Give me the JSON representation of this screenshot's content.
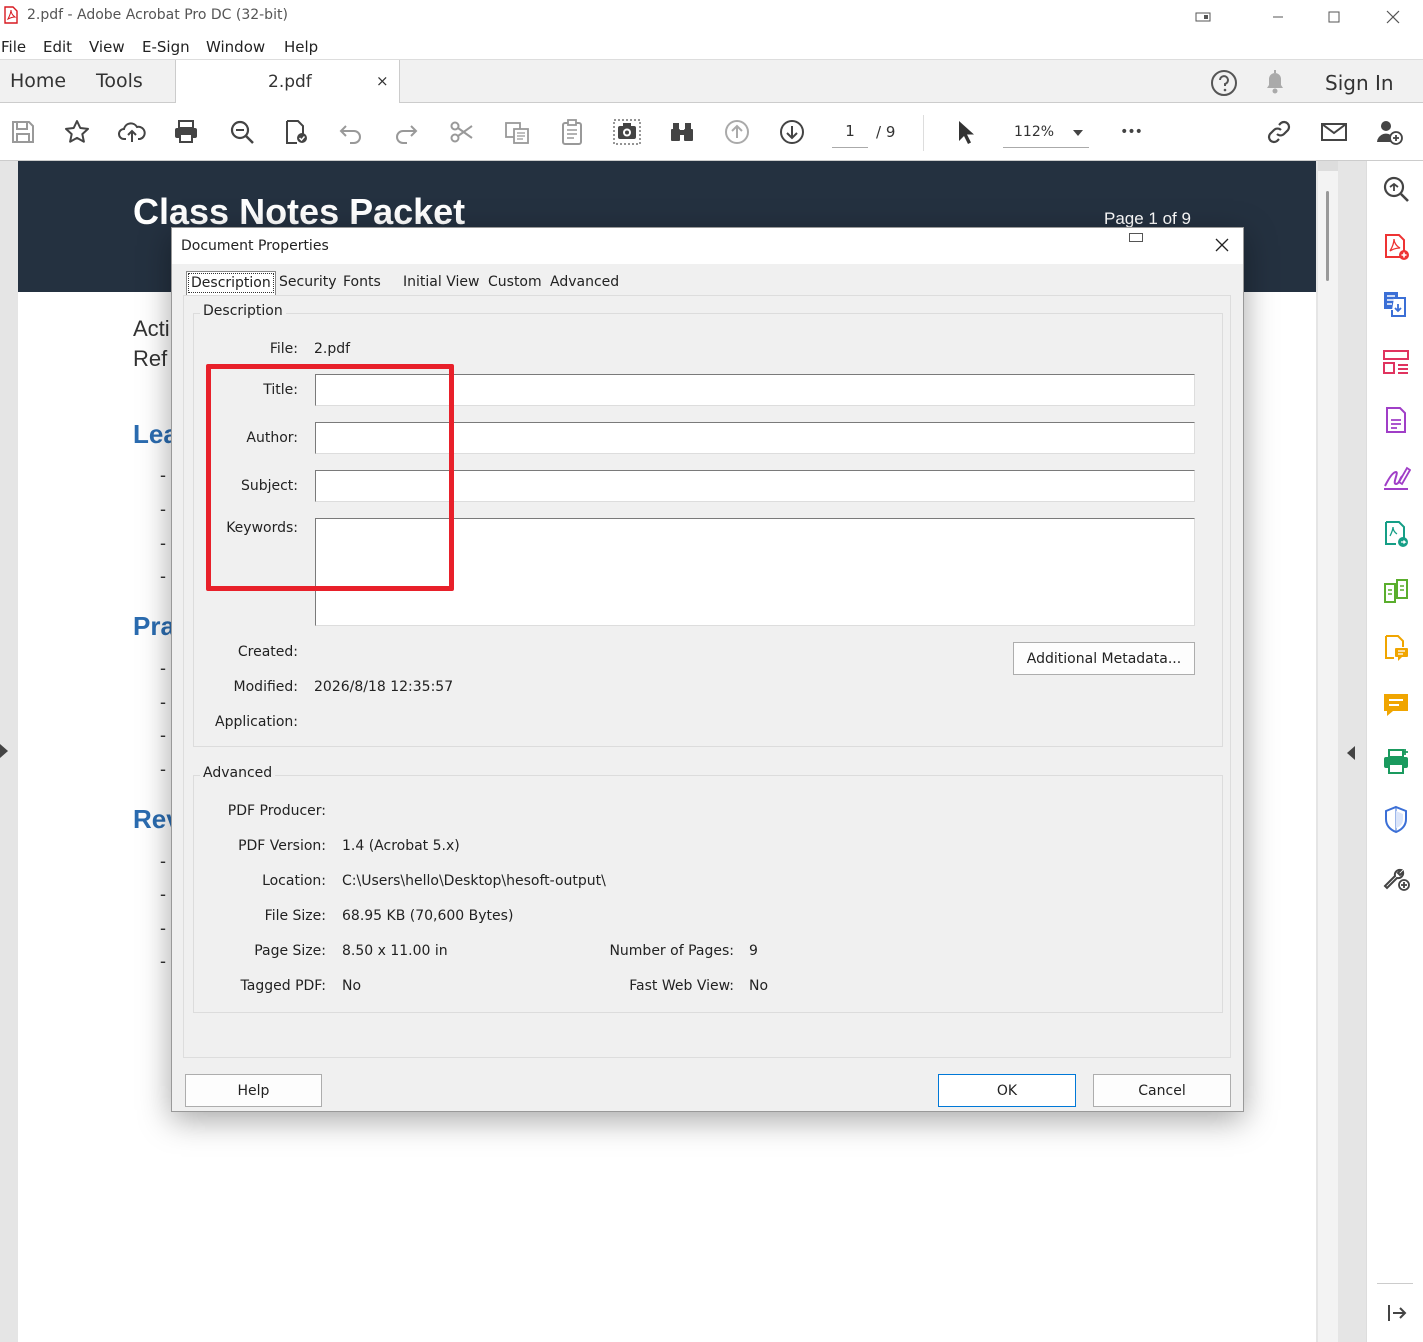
{
  "window": {
    "title": "2.pdf - Adobe Acrobat Pro DC (32-bit)"
  },
  "menubar": [
    "File",
    "Edit",
    "View",
    "E-Sign",
    "Window",
    "Help"
  ],
  "tabbar": {
    "home": "Home",
    "tools": "Tools",
    "document_tab": "2.pdf",
    "close_glyph": "×",
    "sign_in": "Sign In"
  },
  "toolbar": {
    "page_current": "1",
    "page_total": "/ 9",
    "zoom": "112%",
    "more_glyph": "•••"
  },
  "document": {
    "header_title": "Class Notes Packet",
    "header_page": "Page 1 of 9",
    "intro_lines": [
      "Acti",
      "Ref"
    ],
    "sections": [
      {
        "heading": "Lea",
        "bullets": [
          "-",
          "-",
          "-",
          "-"
        ]
      },
      {
        "heading": "Pra",
        "bullets": [
          "-",
          "-",
          "-",
          "-"
        ]
      },
      {
        "heading": "Rev",
        "bullets": [
          "-",
          "-",
          "-",
          "-"
        ]
      }
    ]
  },
  "dialog": {
    "title": "Document Properties",
    "tabs": [
      "Description",
      "Security",
      "Fonts",
      "Initial View",
      "Custom",
      "Advanced"
    ],
    "active_tab": "Description",
    "description_group": {
      "label": "Description",
      "file_label": "File:",
      "file_value": "2.pdf",
      "title_label": "Title:",
      "title_value": "",
      "author_label": "Author:",
      "author_value": "",
      "subject_label": "Subject:",
      "subject_value": "",
      "keywords_label": "Keywords:",
      "keywords_value": "",
      "created_label": "Created:",
      "created_value": "",
      "modified_label": "Modified:",
      "modified_value": "2026/8/18 12:35:57",
      "application_label": "Application:",
      "application_value": "",
      "additional_metadata_button": "Additional Metadata..."
    },
    "advanced_group": {
      "label": "Advanced",
      "pdf_producer_label": "PDF Producer:",
      "pdf_producer_value": "",
      "pdf_version_label": "PDF Version:",
      "pdf_version_value": "1.4 (Acrobat 5.x)",
      "location_label": "Location:",
      "location_value": "C:\\Users\\hello\\Desktop\\hesoft-output\\",
      "file_size_label": "File Size:",
      "file_size_value": "68.95 KB (70,600 Bytes)",
      "page_size_label": "Page Size:",
      "page_size_value": "8.50 x 11.00 in",
      "number_of_pages_label": "Number of Pages:",
      "number_of_pages_value": "9",
      "tagged_pdf_label": "Tagged PDF:",
      "tagged_pdf_value": "No",
      "fast_web_view_label": "Fast Web View:",
      "fast_web_view_value": "No"
    },
    "buttons": {
      "help": "Help",
      "ok": "OK",
      "cancel": "Cancel"
    }
  },
  "colors": {
    "highlight": "#e8202a",
    "doc_header": "#243140",
    "doc_heading": "#2b6cb0"
  },
  "icons": {
    "toolbar": [
      "save-icon",
      "star-icon",
      "upload-cloud-icon",
      "print-icon",
      "search-zoom-icon",
      "check-document-icon",
      "undo-icon",
      "redo-icon",
      "scissors-icon",
      "copy-icon",
      "clipboard-icon",
      "snapshot-icon",
      "binoculars-icon",
      "page-up-icon",
      "page-down-icon",
      "cursor-icon",
      "more-icon",
      "link-icon",
      "email-icon",
      "add-user-icon"
    ],
    "right_panel": [
      "zoom-icon",
      "create-pdf-icon",
      "export-pdf-icon",
      "organize-pages-icon",
      "edit-pdf-icon",
      "fill-sign-icon",
      "send-for-review-icon",
      "compare-icon",
      "comment-doc-icon",
      "comment-icon",
      "print-production-icon",
      "protect-icon",
      "tools-add-icon",
      "collapse-panel-icon"
    ]
  }
}
